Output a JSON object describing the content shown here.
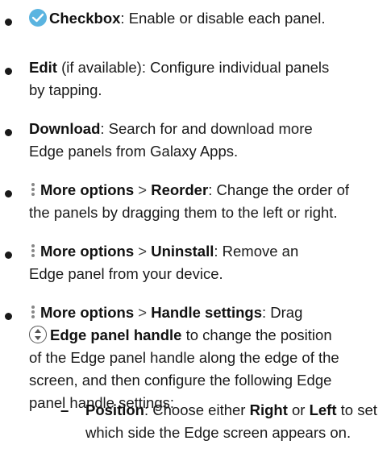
{
  "items": [
    {
      "name": "Checkbox",
      "icon": "checkbox-icon",
      "desc": ": Enable or disable each panel."
    },
    {
      "name": "Edit",
      "desc1": " (if available): Configure individual panels",
      "desc2": "by tapping."
    },
    {
      "name": "Download",
      "desc1": ": Search for and download more",
      "desc2": "Edge panels from Galaxy Apps."
    },
    {
      "icon": "more-options-icon",
      "menu": "More options",
      "sep": ">",
      "action": "Reorder",
      "desc1": ": Change the order of",
      "desc2": "the panels by dragging them to the left or right."
    },
    {
      "icon": "more-options-icon",
      "menu": "More options",
      "sep": ">",
      "action": "Uninstall",
      "desc1": ": Remove an",
      "desc2": "Edge panel from your device."
    },
    {
      "icon": "more-options-icon",
      "menu": "More options",
      "sep": ">",
      "action": "Handle settings",
      "desc1": ": Drag",
      "handle_icon": "edge-panel-handle-icon",
      "handle_label": "Edge panel handle",
      "desc2": " to change the position",
      "desc3": "of the Edge panel handle along the edge of the",
      "desc4": "screen, and then configure the following Edge",
      "desc5": "panel handle settings:"
    }
  ],
  "subitems": [
    {
      "name": "Position",
      "desc_a": ": Choose either ",
      "opt1": "Right",
      "mid": " or ",
      "opt2": "Left",
      "desc_b": " to set",
      "desc2": "which side the Edge screen appears on."
    }
  ],
  "colors": {
    "accent": "#5ab4e0",
    "text": "#1a1a1a"
  }
}
